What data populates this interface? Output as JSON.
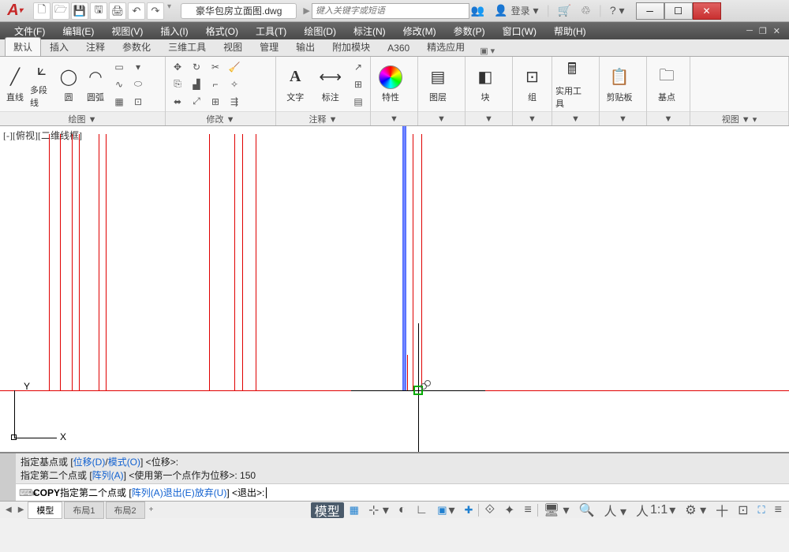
{
  "title": {
    "doc": "豪华包房立面图.dwg",
    "search_placeholder": "键入关键字或短语",
    "login": "登录"
  },
  "menu": {
    "items": [
      "文件(F)",
      "编辑(E)",
      "视图(V)",
      "插入(I)",
      "格式(O)",
      "工具(T)",
      "绘图(D)",
      "标注(N)",
      "修改(M)",
      "参数(P)",
      "窗口(W)",
      "帮助(H)"
    ]
  },
  "tabs": {
    "items": [
      "默认",
      "插入",
      "注释",
      "参数化",
      "三维工具",
      "视图",
      "管理",
      "输出",
      "附加模块",
      "A360",
      "精选应用"
    ],
    "active": 0
  },
  "ribbon": {
    "draw": {
      "title": "绘图 ▼",
      "line": "直线",
      "polyline": "多段线",
      "circle": "圆",
      "arc": "圆弧"
    },
    "modify": {
      "title": "修改 ▼"
    },
    "annot": {
      "title": "注释 ▼",
      "text": "文字",
      "dim": "标注"
    },
    "props": {
      "title": "特性"
    },
    "layers": {
      "title": "图层"
    },
    "block": {
      "title": "块"
    },
    "group": {
      "title": "组"
    },
    "util": {
      "title": "实用工具"
    },
    "clip": {
      "title": "剪贴板"
    },
    "base": {
      "title": "基点"
    },
    "view": {
      "title": "视图 ▼ ▾"
    }
  },
  "viewport": {
    "label": "[-][俯视][二维线框]"
  },
  "cmd": {
    "hist1_a": "指定基点或 [",
    "hist1_b": "位移(D)",
    "hist1_c": "/",
    "hist1_d": "模式(O)",
    "hist1_e": "] <位移>:",
    "hist2_a": "指定第二个点或 [",
    "hist2_b": "阵列(A)",
    "hist2_c": "] <使用第一个点作为位移>: 150",
    "line_cmd": "COPY",
    "line_a": " 指定第二个点或 [",
    "line_b": "阵列(A)",
    "line_sp1": " ",
    "line_c": "退出(E)",
    "line_sp2": " ",
    "line_d": "放弃(U)",
    "line_e": "] <退出>: "
  },
  "layout": {
    "model": "模型",
    "l1": "布局1",
    "l2": "布局2"
  },
  "status": {
    "model": "模型",
    "scale": "1:1",
    "extra": "十"
  }
}
